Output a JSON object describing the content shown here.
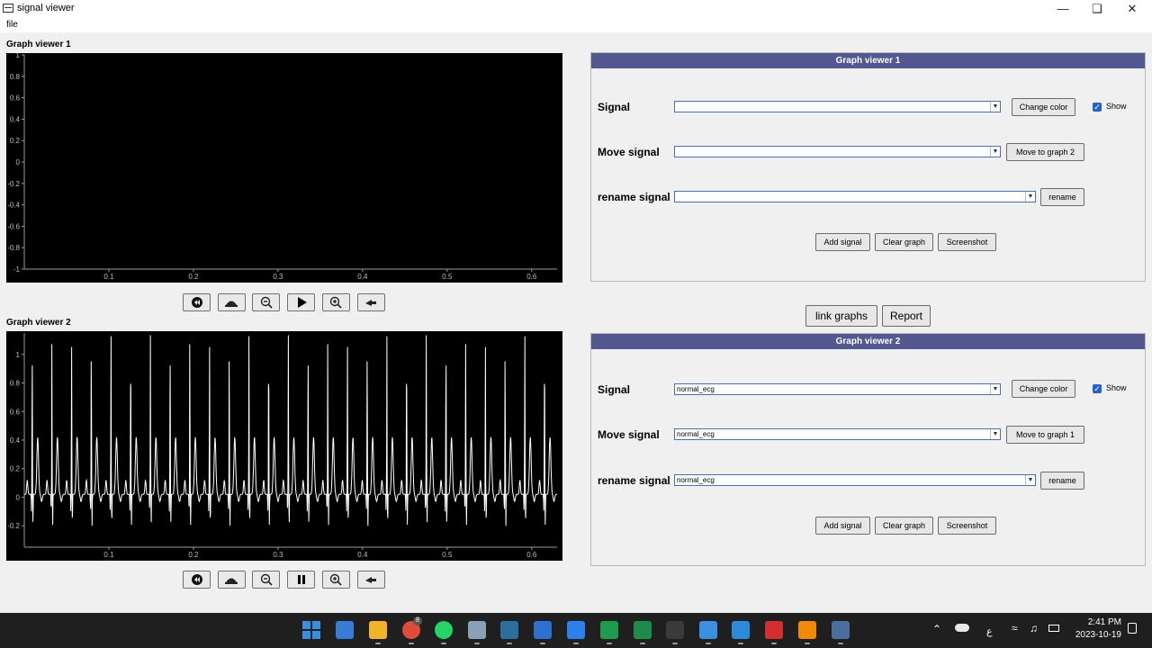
{
  "window": {
    "title": "signal viewer"
  },
  "menu": {
    "file": "file"
  },
  "viewer1": {
    "label": "Graph viewer 1",
    "y_ticks": [
      "1",
      "0.8",
      "0.6",
      "0.4",
      "0.2",
      "0",
      "-0.2",
      "-0.4",
      "-0.6",
      "-0.8",
      "-1"
    ],
    "x_ticks": [
      "0.1",
      "0.2",
      "0.3",
      "0.4",
      "0.5",
      "0.6"
    ],
    "toolbar": [
      "rewind-icon",
      "slow-down-icon",
      "zoom-out-icon",
      "play-icon",
      "zoom-in-icon",
      "speed-up-icon"
    ]
  },
  "viewer2": {
    "label": "Graph viewer 2",
    "y_ticks": [
      "1",
      "0.8",
      "0.6",
      "0.4",
      "0.2",
      "0",
      "-0.2"
    ],
    "x_ticks": [
      "0.1",
      "0.2",
      "0.3",
      "0.4",
      "0.5",
      "0.6"
    ],
    "toolbar": [
      "rewind-icon",
      "slow-down-icon",
      "zoom-out-icon",
      "pause-icon",
      "zoom-in-icon",
      "speed-up-icon"
    ]
  },
  "chart_data": [
    {
      "type": "line",
      "xlim": [
        0.0,
        0.63
      ],
      "ylim": [
        -1.0,
        1.0
      ],
      "series": []
    },
    {
      "type": "line",
      "xlim": [
        0.0,
        0.63
      ],
      "ylim": [
        -0.35,
        1.15
      ],
      "series": [
        {
          "name": "normal_ecg",
          "color": "#ffffff",
          "beat_period": 0.0233
        }
      ]
    }
  ],
  "panel1": {
    "header": "Graph viewer 1",
    "signal_label": "Signal",
    "signal_value": "",
    "change_color": "Change color",
    "show_label": "Show",
    "show_checked": true,
    "move_label": "Move signal",
    "move_value": "",
    "move_button": "Move to graph 2",
    "rename_label": "rename signal",
    "rename_value": "",
    "rename_button": "rename",
    "add_signal": "Add signal",
    "clear_graph": "Clear graph",
    "screenshot": "Screenshot"
  },
  "panel2": {
    "header": "Graph viewer 2",
    "signal_label": "Signal",
    "signal_value": "normal_ecg",
    "change_color": "Change color",
    "show_label": "Show",
    "show_checked": true,
    "move_label": "Move signal",
    "move_value": "normal_ecg",
    "move_button": "Move to graph 1",
    "rename_label": "rename signal",
    "rename_value": "normal_ecg",
    "rename_button": "rename",
    "add_signal": "Add signal",
    "clear_graph": "Clear graph",
    "screenshot": "Screenshot"
  },
  "center": {
    "link_graphs": "link graphs",
    "report": "Report"
  },
  "taskbar": {
    "apps": [
      {
        "name": "start-icon",
        "color": "#3b8de0"
      },
      {
        "name": "store-icon",
        "color": "#3b7bd8"
      },
      {
        "name": "file-explorer-icon",
        "color": "#f0b429"
      },
      {
        "name": "chrome-icon",
        "color": "#dd4b39"
      },
      {
        "name": "whatsapp-icon",
        "color": "#25d366"
      },
      {
        "name": "settings-icon",
        "color": "#8aa0b6"
      },
      {
        "name": "terminal-icon",
        "color": "#2a6f9e"
      },
      {
        "name": "mail-icon",
        "color": "#2f6fd0"
      },
      {
        "name": "calendar-icon",
        "color": "#2f80ed"
      },
      {
        "name": "app-d-icon",
        "color": "#1c9c4c"
      },
      {
        "name": "excel-icon",
        "color": "#1e8a4c"
      },
      {
        "name": "console-icon",
        "color": "#3a3a3a"
      },
      {
        "name": "notepad-icon",
        "color": "#3d8fe0"
      },
      {
        "name": "vscode-icon",
        "color": "#2c8ad8"
      },
      {
        "name": "acrobat-icon",
        "color": "#d32f2f"
      },
      {
        "name": "vlc-icon",
        "color": "#f08a00"
      },
      {
        "name": "python-icon",
        "color": "#4a6f9c"
      }
    ],
    "chrome_badge": "8",
    "time": "2:41 PM",
    "date": "2023-10-19",
    "lang": "ع"
  }
}
